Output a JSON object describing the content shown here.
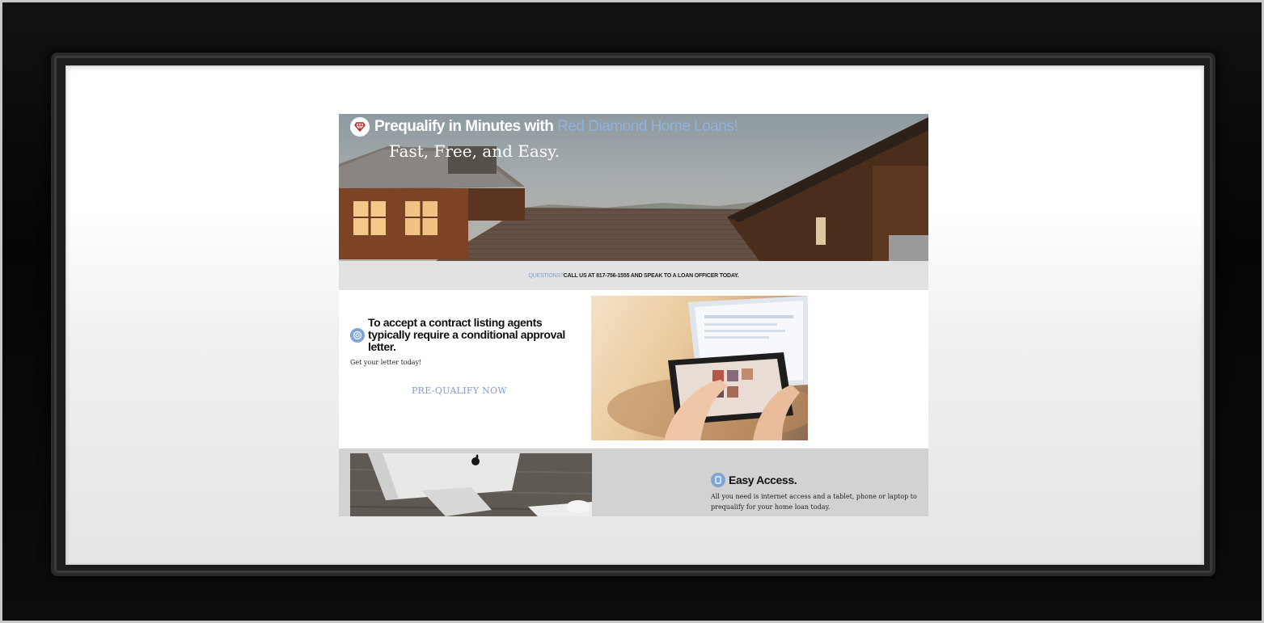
{
  "hero": {
    "title_prefix": "Prequalify in Minutes with ",
    "brand_name": "Red Diamond Home Loans!",
    "subtitle": "Fast, Free, and Easy.",
    "badge_icon": "diamond-icon"
  },
  "question_bar": {
    "label": "QUESTIONS?",
    "text": " CALL US AT 817-756-1555 AND SPEAK TO A LOAN OFFICER TODAY."
  },
  "section_approval": {
    "icon": "target-icon",
    "heading": "To accept a contract listing agents typically require a conditional approval letter.",
    "subtext": "Get your letter today!",
    "cta_label": "PRE-QUALIFY NOW",
    "image": "hands-using-tablet-photo"
  },
  "section_access": {
    "icon": "tablet-icon",
    "heading": "Easy Access.",
    "body": "All you need is internet access and a tablet, phone or laptop to prequalify for your home loan today.",
    "image": "imac-on-desk-photo"
  },
  "colors": {
    "accent_blue": "#7c9fcf",
    "frame": "#0a0a0a",
    "question_bar_bg": "#e2e2e2",
    "section2_bg": "#d2d2d2"
  }
}
